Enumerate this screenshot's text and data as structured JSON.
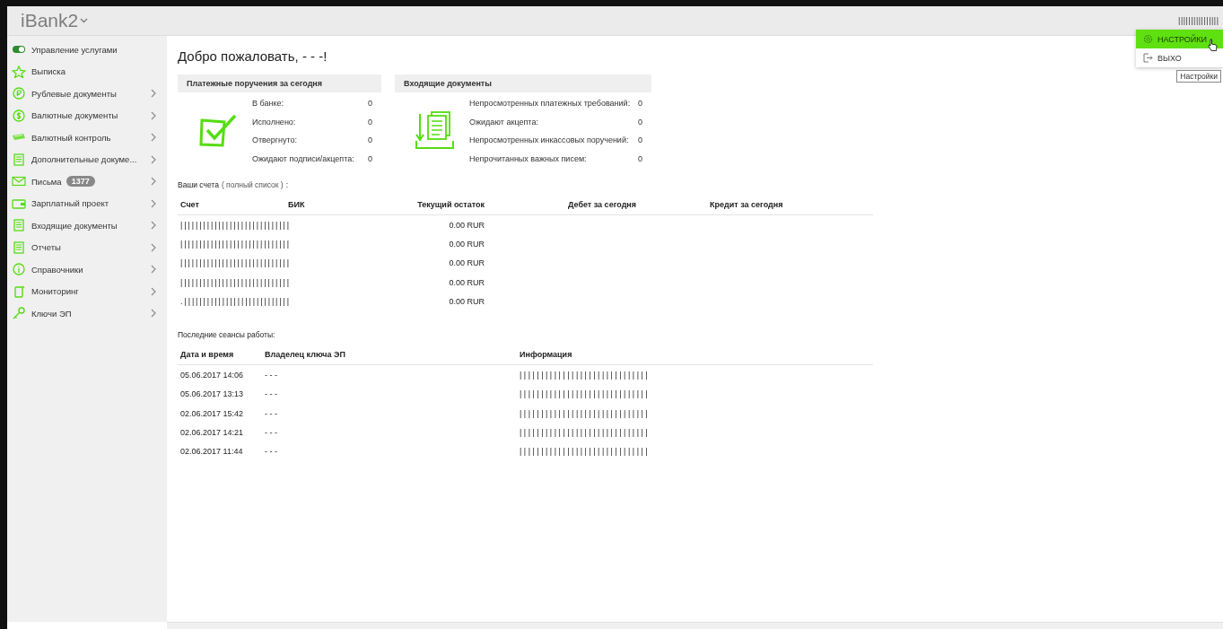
{
  "header": {
    "logo": "iBank2",
    "user": "| | | | | | | | | | | | | | | |"
  },
  "user_menu": {
    "items": [
      {
        "label": "НАСТРОЙКИ",
        "selected": true
      },
      {
        "label": "ВЫХО",
        "selected": false
      }
    ],
    "tooltip": "Настройки"
  },
  "sidebar": {
    "items": [
      {
        "label": "Управление услугами",
        "expandable": false
      },
      {
        "label": "Выписка",
        "expandable": false
      },
      {
        "label": "Рублевые документы",
        "expandable": true
      },
      {
        "label": "Валютные документы",
        "expandable": true
      },
      {
        "label": "Валютный контроль",
        "expandable": true
      },
      {
        "label": "Дополнительные докуме...",
        "expandable": true
      },
      {
        "label": "Письма",
        "badge": "1377",
        "expandable": true
      },
      {
        "label": "Зарплатный проект",
        "expandable": true
      },
      {
        "label": "Входящие документы",
        "expandable": true
      },
      {
        "label": "Отчеты",
        "expandable": true
      },
      {
        "label": "Справочники",
        "expandable": true
      },
      {
        "label": "Мониторинг",
        "expandable": true
      },
      {
        "label": "Ключи ЭП",
        "expandable": true
      }
    ]
  },
  "welcome": "Добро пожаловать, - - -!",
  "panels": [
    {
      "title": "Платежные поручения за сегодня",
      "rows": [
        {
          "label": "В банке:",
          "value": "0"
        },
        {
          "label": "Исполнено:",
          "value": "0"
        },
        {
          "label": "Отвергнуто:",
          "value": "0"
        },
        {
          "label": "Ожидают подписи/акцепта:",
          "value": "0"
        }
      ]
    },
    {
      "title": "Входящие документы",
      "rows": [
        {
          "label": "Непросмотренных платежных требований:",
          "value": "0"
        },
        {
          "label": "Ожидают акцепта:",
          "value": "0"
        },
        {
          "label": "Непросмотренных инкассовых поручений:",
          "value": "0"
        },
        {
          "label": "Непрочитанных важных писем:",
          "value": "0"
        }
      ]
    }
  ],
  "accounts": {
    "caption": "Ваши счета",
    "link": "( полный список )",
    "suffix": ":",
    "columns": [
      "Счет",
      "БИК",
      "Текущий остаток",
      "Дебет за сегодня",
      "Кредит за сегодня"
    ],
    "rows": [
      {
        "account": "| | | | | | | | | | | | | | | | | | | | | | | | | | | | |",
        "balance": "0.00 RUR"
      },
      {
        "account": "| | | | | | | | | | | | | | | | | | | | | | | | | | | | |",
        "balance": "0.00 RUR"
      },
      {
        "account": "| | | | | | | | | | | | | | | | | | | | | | | | | | | | |",
        "balance": "0.00 RUR"
      },
      {
        "account": "| | | | | | | | | | | | | | | | | | | | | | | | | | | | |",
        "balance": "0.00 RUR"
      },
      {
        "account": ". | | | | | | | | | | | | | | | | | | | | | | | | | | | |",
        "balance": "0.00 RUR"
      }
    ]
  },
  "sessions": {
    "caption": "Последние сеансы работы:",
    "columns": [
      "Дата и время",
      "Владелец ключа ЭП",
      "Информация"
    ],
    "rows": [
      {
        "date": "05.06.2017 14:06",
        "owner": "- - -",
        "info": "| | | | | | | | | | | | | | | | | | | | | | | | | | | | | |"
      },
      {
        "date": "05.06.2017 13:13",
        "owner": "- - -",
        "info": "| | | | | | | | | | | | | | | | | | | | | | | | | | | | | |"
      },
      {
        "date": "02.06.2017 15:42",
        "owner": "- - -",
        "info": "| | | | | | | | | | | | | | | | | | | | | | | | | | | | | |"
      },
      {
        "date": "02.06.2017 14:21",
        "owner": "- - -",
        "info": "| | | | | | | | | | | | | | | | | | | | | | | | | | | | | |"
      },
      {
        "date": "02.06.2017 11:44",
        "owner": "- - -",
        "info": "| | | | | | | | | | | | | | | | | | | | | | | | | | | | | |"
      }
    ]
  }
}
